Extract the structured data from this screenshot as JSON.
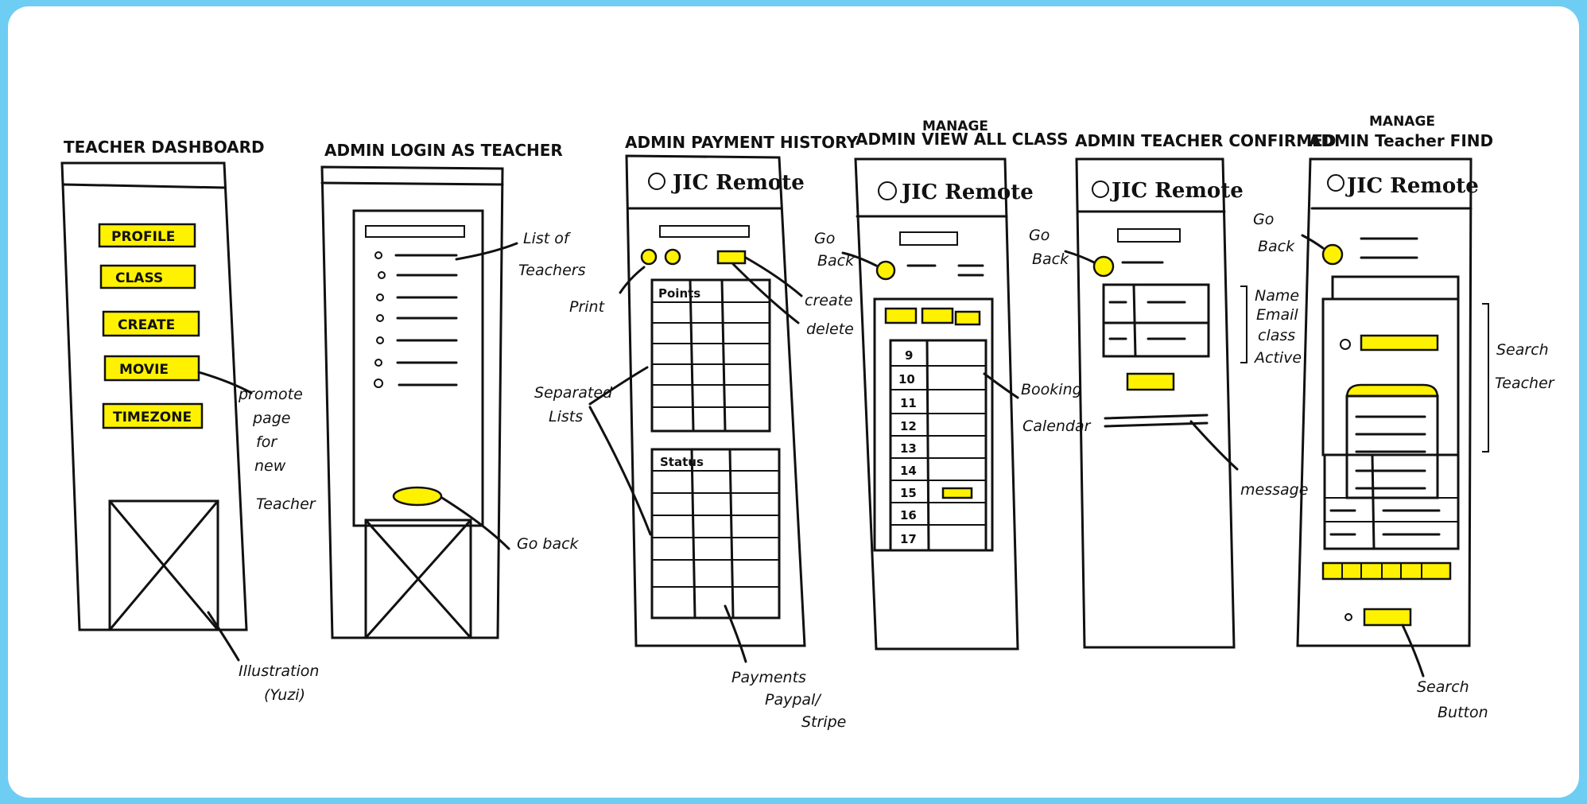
{
  "accent": "#fff200",
  "frame_color": "#6ecdf2",
  "titles": {
    "s1": "TEACHER DASHBOARD",
    "s2": "ADMIN LOGIN AS TEACHER",
    "s3": "ADMIN PAYMENT HISTORY",
    "s4": "ADMIN VIEW ALL CLASS",
    "s5_line1": "MANAGE",
    "s5_line2": "ADMIN TEACHER CONFIRMED",
    "s6_line1": "MANAGE",
    "s6_line2": "ADMIN Teacher FIND"
  },
  "app_header": "JIC Remote",
  "dashboard_buttons": [
    "PROFILE",
    "CLASS",
    "CREATE",
    "MOVIE",
    "TIMEZONE"
  ],
  "table_headers": {
    "top": "Points",
    "bottom": "Status"
  },
  "calendar_rows": [
    "9",
    "10",
    "11",
    "12",
    "13",
    "14",
    "15",
    "16",
    "17"
  ],
  "annotations": {
    "promote": [
      "promote",
      "page",
      "for",
      "new",
      "Teacher"
    ],
    "illustration": [
      "Illustration",
      "(Yuzi)"
    ],
    "list_of_teachers": [
      "List of",
      "Teachers"
    ],
    "go_back": "Go back",
    "print": "Print",
    "create": "create",
    "delete": "delete",
    "separated_lists": [
      "Separated",
      "Lists"
    ],
    "payments": [
      "Payments",
      "Paypal/",
      "Stripe"
    ],
    "go_back_s4": [
      "Go",
      "Back"
    ],
    "booking_calendar": [
      "Booking",
      "Calendar"
    ],
    "go_back_s5": [
      "Go",
      "Back"
    ],
    "name_email": [
      "Name",
      "Email",
      "class",
      "Active"
    ],
    "message": "message",
    "go_back_s6": [
      "Go",
      "Back"
    ],
    "search_teacher": [
      "Search",
      "Teacher"
    ],
    "search_button": [
      "Search",
      "Button"
    ]
  }
}
